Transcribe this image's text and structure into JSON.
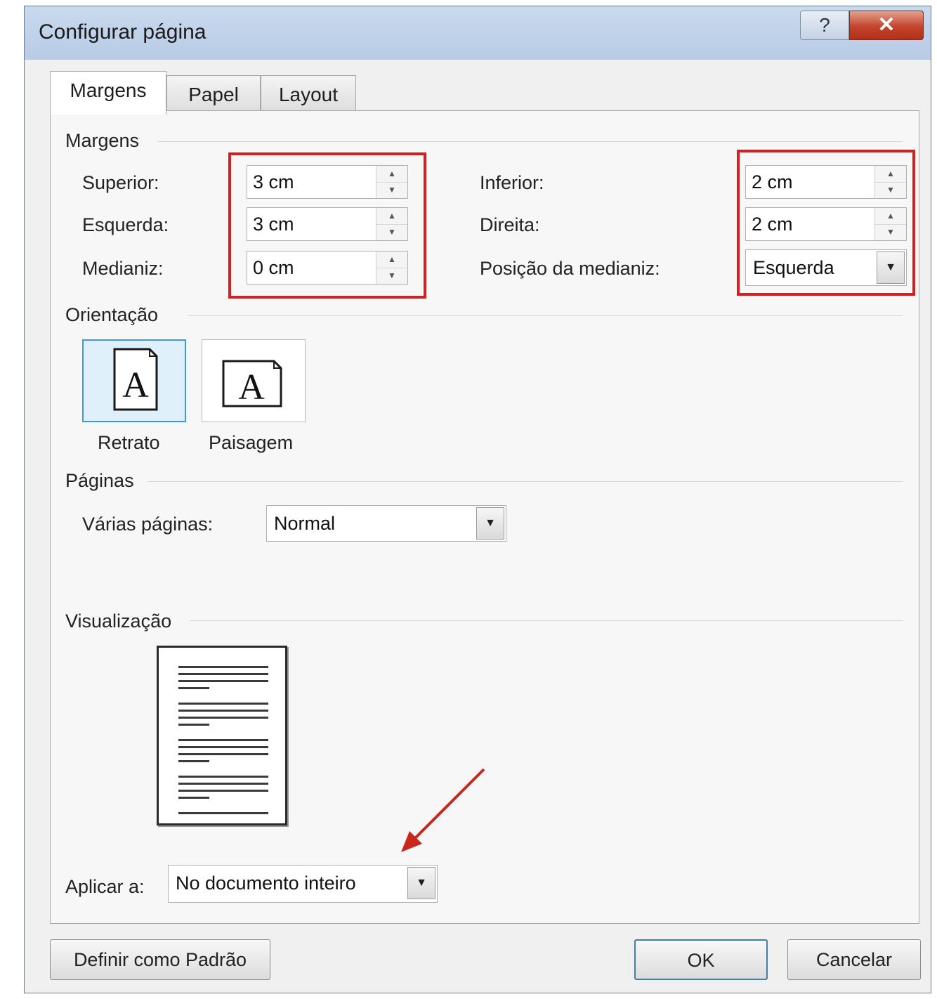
{
  "dialog": {
    "title": "Configurar página",
    "help_glyph": "?",
    "close_glyph": "✕"
  },
  "tabs": [
    {
      "label": "Margens",
      "active": true
    },
    {
      "label": "Papel",
      "active": false
    },
    {
      "label": "Layout",
      "active": false
    }
  ],
  "margins": {
    "section_title": "Margens",
    "top": {
      "label": "Superior:",
      "value": "3 cm"
    },
    "left": {
      "label": "Esquerda:",
      "value": "3 cm"
    },
    "gutter": {
      "label": "Medianiz:",
      "value": "0 cm"
    },
    "bottom": {
      "label": "Inferior:",
      "value": "2 cm"
    },
    "right": {
      "label": "Direita:",
      "value": "2 cm"
    },
    "gutter_position": {
      "label": "Posição da medianiz:",
      "value": "Esquerda"
    }
  },
  "orientation": {
    "section_title": "Orientação",
    "portrait": {
      "label": "Retrato",
      "glyph": "A",
      "selected": true
    },
    "landscape": {
      "label": "Paisagem",
      "glyph": "A",
      "selected": false
    }
  },
  "pages": {
    "section_title": "Páginas",
    "multiple_pages": {
      "label": "Várias páginas:",
      "value": "Normal"
    }
  },
  "preview": {
    "section_title": "Visualização"
  },
  "apply_to": {
    "label": "Aplicar a:",
    "value": "No documento inteiro"
  },
  "buttons": {
    "set_default": "Definir como Padrão",
    "ok": "OK",
    "cancel": "Cancelar"
  },
  "icons": {
    "spin_up": "▲",
    "spin_down": "▼",
    "dropdown": "▼"
  },
  "colors": {
    "highlight_red": "#d42020",
    "arrow_red": "#c8281e",
    "selected_blue": "#3f9bd6"
  }
}
